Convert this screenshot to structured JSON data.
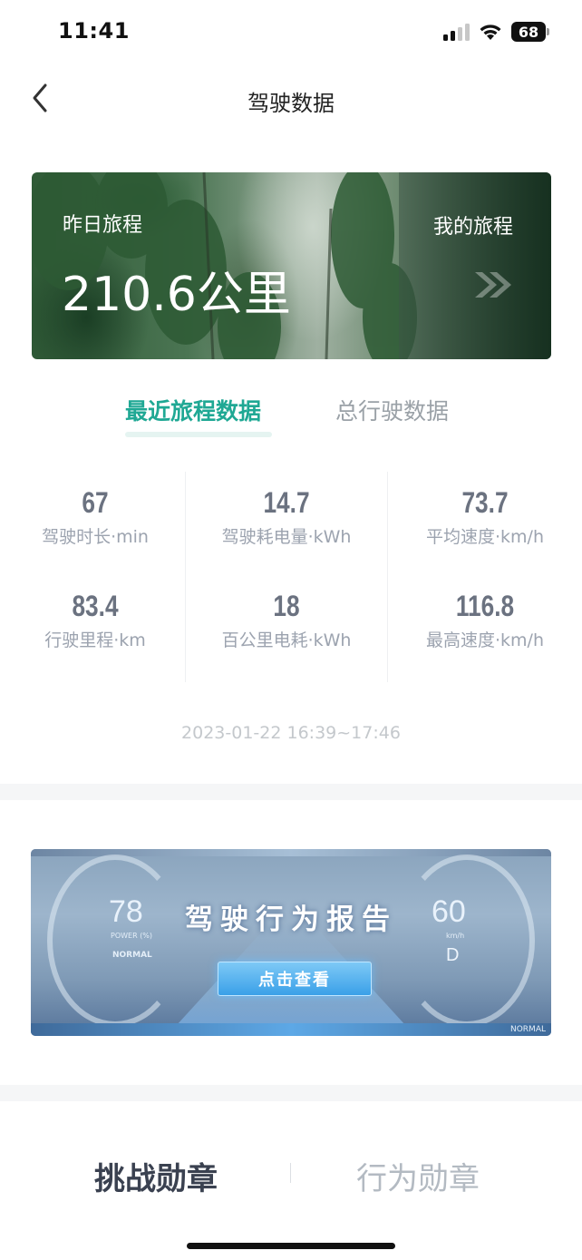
{
  "status_bar": {
    "time": "11:41",
    "battery": "68"
  },
  "header": {
    "title": "驾驶数据"
  },
  "trip_banner": {
    "label": "昨日旅程",
    "distance": "210.6公里",
    "my_trips_label": "我的旅程"
  },
  "tabs": [
    {
      "label": "最近旅程数据",
      "active": true
    },
    {
      "label": "总行驶数据",
      "active": false
    }
  ],
  "stats": [
    {
      "value": "67",
      "label": "驾驶时长·min"
    },
    {
      "value": "14.7",
      "label": "驾驶耗电量·kWh"
    },
    {
      "value": "73.7",
      "label": "平均速度·km/h"
    },
    {
      "value": "83.4",
      "label": "行驶里程·km"
    },
    {
      "value": "18",
      "label": "百公里电耗·kWh"
    },
    {
      "value": "116.8",
      "label": "最高速度·km/h"
    }
  ],
  "time_range": "2023-01-22 16:39~17:46",
  "report_banner": {
    "power_value": "78",
    "power_label": "POWER (%)",
    "mode_left": "NORMAL",
    "title": "驾驶行为报告",
    "speed_value": "60",
    "speed_unit": "km/h",
    "gear": "D",
    "button_label": "点击查看",
    "mode_right": "NORMAL"
  },
  "medal_tabs": [
    {
      "label": "挑战勋章",
      "active": true
    },
    {
      "label": "行为勋章",
      "active": false
    }
  ],
  "colors": {
    "accent": "#1fa894",
    "stat_value": "#6b7280",
    "stat_label": "#9ca3af"
  }
}
